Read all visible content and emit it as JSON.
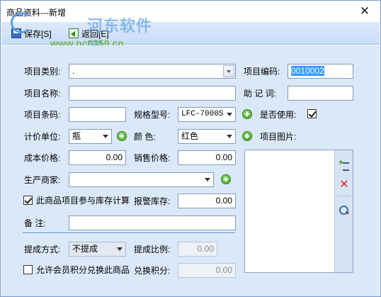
{
  "window": {
    "title": "商品资料---新增",
    "close_glyph": "✕"
  },
  "toolbar": {
    "save_label": "保存[S]",
    "back_label": "返回[E]"
  },
  "watermark": {
    "text": "河东软件园",
    "url": "www.pc0359.cn"
  },
  "form": {
    "category_label": "项目类别:",
    "category_value": ".",
    "code_label": "项目编码:",
    "code_value": "0010002",
    "name_label": "项目名称:",
    "name_value": "",
    "mnemonic_label": "助 记 词:",
    "mnemonic_value": "",
    "barcode_label": "项目条码:",
    "barcode_value": "",
    "spec_label": "规格型号:",
    "spec_value": "LFC-7000S",
    "enabled_label": "是否使用:",
    "enabled_checked": true,
    "unit_label": "计价单位:",
    "unit_value": "瓶",
    "color_label": "颜    色:",
    "color_value": "红色",
    "image_label": "项目图片:",
    "cost_label": "成本价格:",
    "cost_value": "0.00",
    "sale_label": "销售价格:",
    "sale_value": "0.00",
    "maker_label": "生产商家:",
    "maker_value": "",
    "stock_calc_label": "此商品项目参与库存计算",
    "stock_calc_checked": true,
    "alert_stock_label": "报警库存:",
    "alert_stock_value": "0.00",
    "note_label": "备    注:",
    "note_value": "",
    "commission_mode_label": "提成方式:",
    "commission_mode_value": "不提成",
    "commission_ratio_label": "提成比例:",
    "commission_ratio_value": "0.00",
    "points_label": "允许会员积分兑换此商品",
    "points_checked": false,
    "points_value_label": "兑换积分:",
    "points_value": "0.00"
  },
  "icons": {
    "save": "save-disk-icon",
    "back": "back-arrow-icon",
    "add_image": "add-image-icon",
    "delete_image": "delete-icon",
    "zoom_image": "magnifier-icon"
  },
  "colors": {
    "form_bg": "#dbe8f8",
    "toolbar_bg": "#c9dcf6",
    "selection": "#3399ff",
    "plus": "#3aa31f",
    "delete": "#e02a2a"
  }
}
